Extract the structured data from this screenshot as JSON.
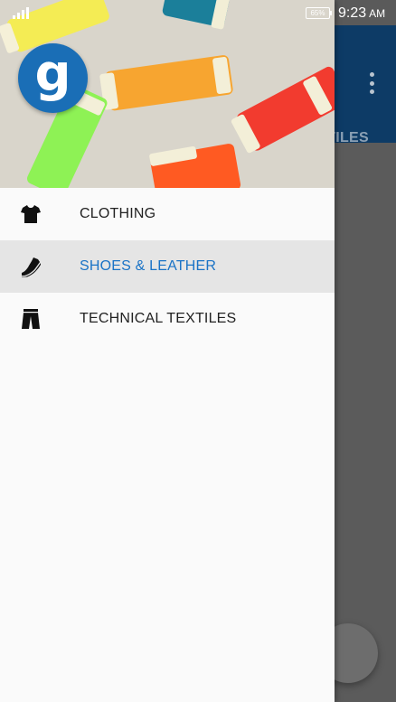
{
  "status_bar": {
    "battery": "65%",
    "time": "9:23",
    "ampm": "AM"
  },
  "background_app": {
    "visible_tab_fragment": "TILES",
    "overflow_icon": "more-vert-icon"
  },
  "drawer": {
    "logo_letter": "g",
    "items": [
      {
        "label": "CLOTHING",
        "icon": "tshirt-icon",
        "active": false
      },
      {
        "label": "SHOES & LEATHER",
        "icon": "shoe-icon",
        "active": true
      },
      {
        "label": "TECHNICAL TEXTILES",
        "icon": "pants-icon",
        "active": false
      }
    ]
  },
  "colors": {
    "toolbar": "#0d3b66",
    "accent": "#1a73c6",
    "logo_bg": "#1a6eb6",
    "active_item_bg": "#e5e5e5"
  }
}
